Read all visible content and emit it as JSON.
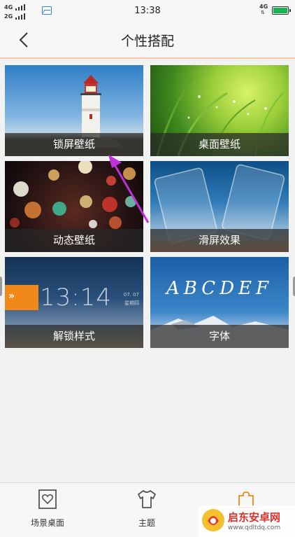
{
  "status_bar": {
    "signal_1": "4G",
    "signal_2": "2G",
    "time": "13:38",
    "network": "4G",
    "icons": [
      "gallery-icon",
      "battery-icon"
    ],
    "battery_color": "#17b54b"
  },
  "header": {
    "title": "个性搭配",
    "back_icon": "chevron-left-icon"
  },
  "tiles": [
    {
      "label": "锁屏壁纸"
    },
    {
      "label": "桌面壁纸"
    },
    {
      "label": "动态壁纸"
    },
    {
      "label": "滑屏效果"
    },
    {
      "label": "解锁样式",
      "preview_time": "13:14",
      "preview_date": "07. 07",
      "preview_weekday": "星期四"
    },
    {
      "label": "字体",
      "preview_text": "ABCDEF"
    }
  ],
  "bottom_nav": {
    "items": [
      {
        "label": "场景桌面",
        "icon": "frame-heart-icon"
      },
      {
        "label": "主题",
        "icon": "tshirt-icon"
      },
      {
        "label": "",
        "icon": "puzzle-icon",
        "active_color": "#f0881a"
      }
    ]
  },
  "annotation": {
    "color": "#c030d8"
  },
  "watermark": {
    "text": "启东安卓网",
    "url": "www.qdltdq.com"
  }
}
